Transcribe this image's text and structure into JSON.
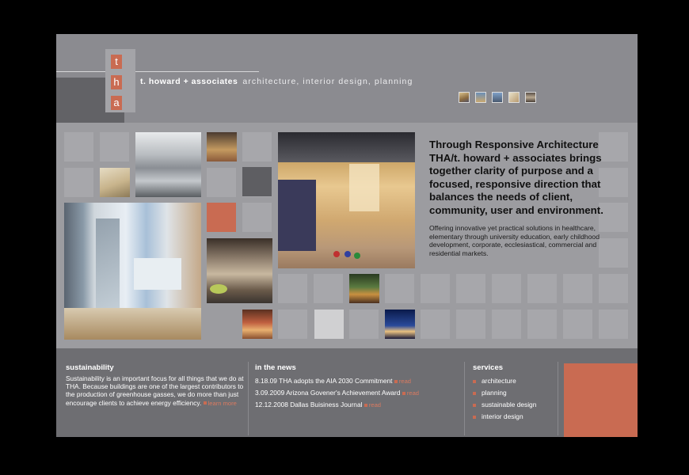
{
  "logo": {
    "letters": [
      "t",
      "h",
      "a"
    ]
  },
  "header": {
    "firm": "t. howard + associates",
    "tagline": "architecture, interior design, planning"
  },
  "thumbnails": [
    "project-thumb-1",
    "project-thumb-2",
    "project-thumb-3",
    "project-thumb-4",
    "project-thumb-5"
  ],
  "intro": {
    "headline": "Through Responsive Architecture THA/t. howard + associates brings together clarity of purpose and a focused, responsive direction that balances the needs of client, community, user and environment.",
    "body": "Offering innovative yet practical solutions in healthcare, elementary through university education, early childhood development, corporate, ecclesiastical, commercial and residential markets."
  },
  "sustainability": {
    "heading": "sustainability",
    "text": "Sustainability is an important focus for all things that we do at THA. Because buildings are one of the largest contributors to the production of greenhouse gasses, we do more than just encourage clients to achieve energy efficiency.",
    "more_label": "learn more"
  },
  "news": {
    "heading": "in the news",
    "items": [
      {
        "text": "8.18.09  THA adopts the AIA 2030 Commitment",
        "link": "read"
      },
      {
        "text": "3.09.2009  Arizona Govener's Achievement Award",
        "link": "read"
      },
      {
        "text": "12.12.2008  Dallas Buisiness Journal",
        "link": "read"
      }
    ]
  },
  "services": {
    "heading": "services",
    "items": [
      "architecture",
      "planning",
      "sustainable design",
      "interior design"
    ]
  },
  "colors": {
    "accent": "#c96b52",
    "background": "#9c9ca0",
    "footer": "#6e6e72",
    "dark": "#5e5e62"
  }
}
